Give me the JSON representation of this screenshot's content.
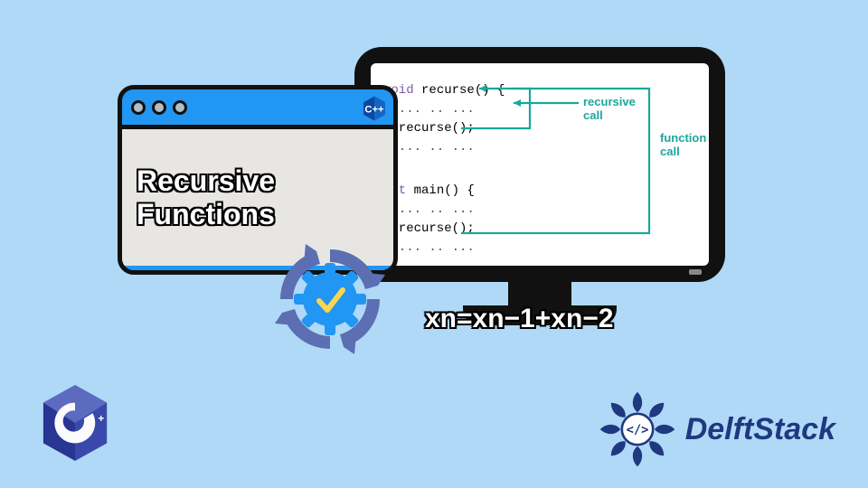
{
  "window": {
    "title_line1": "Recursive",
    "title_line2": "Functions",
    "dots": 3,
    "badge_icon": "cpp-hex-icon"
  },
  "monitor": {
    "code": {
      "l1_kw": "void",
      "l1_rest": " recurse() {",
      "l2": "  ... .. ...",
      "l3": "  recurse();",
      "l4": "  ... .. ...",
      "l5": "}",
      "l6_kw": "int",
      "l6_rest": " main() {",
      "l7": "  ... .. ...",
      "l8": "  recurse();",
      "l9": "  ... .. ..."
    },
    "labels": {
      "recursive_l1": "recursive",
      "recursive_l2": "call",
      "function_l1": "function",
      "function_l2": "call"
    }
  },
  "equation": "xn=xn−1+xn−2",
  "badge": {
    "icon": "gear-check-cycle-icon"
  },
  "bottom_left_logo": "cpp-hex-icon",
  "brand": {
    "name": "DelftStack",
    "emblem": "mandala-code-icon"
  },
  "colors": {
    "bg": "#afd9f7",
    "blue": "#2196f3",
    "teal": "#1aa79c",
    "indigo": "#5b6fb2",
    "navy": "#203880"
  }
}
